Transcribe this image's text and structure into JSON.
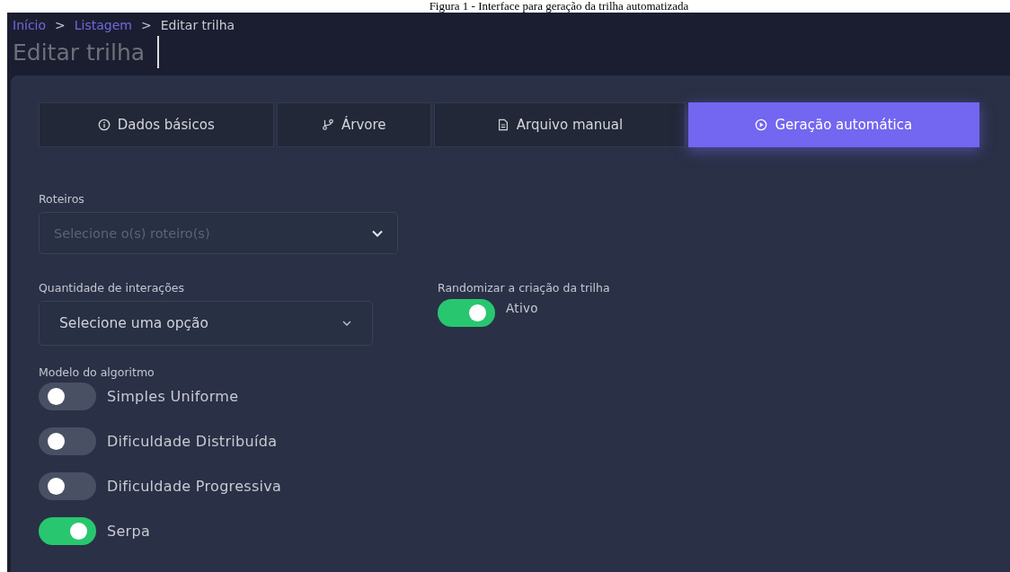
{
  "caption": "Figura 1 - Interface para geração da trilha automatizada",
  "breadcrumb": [
    {
      "label": "Início",
      "link": true
    },
    {
      "label": "Listagem",
      "link": true
    },
    {
      "label": "Editar trilha",
      "link": false
    }
  ],
  "breadcrumb_separator": ">",
  "page_title": "Editar trilha",
  "tabs": [
    {
      "label": "Dados básicos",
      "kind": "info",
      "selected": false
    },
    {
      "label": "Árvore",
      "kind": "branch",
      "selected": false
    },
    {
      "label": "Arquivo manual",
      "kind": "file",
      "selected": false
    },
    {
      "label": "Geração automática",
      "kind": "play",
      "selected": true
    }
  ],
  "roteiros": {
    "label": "Roteiros",
    "placeholder": "Selecione o(s) roteiro(s)"
  },
  "quantidade": {
    "label": "Quantidade de interações",
    "value": "Selecione uma opção"
  },
  "randomizar": {
    "label": "Randomizar a criação da trilha",
    "on": true,
    "state_text": "Ativo"
  },
  "modelo": {
    "label": "Modelo do algoritmo",
    "options": [
      {
        "label": "Simples Uniforme",
        "on": false
      },
      {
        "label": "Dificuldade Distribuída",
        "on": false
      },
      {
        "label": "Dificuldade Progressiva",
        "on": false
      },
      {
        "label": "Serpa",
        "on": true
      }
    ]
  }
}
